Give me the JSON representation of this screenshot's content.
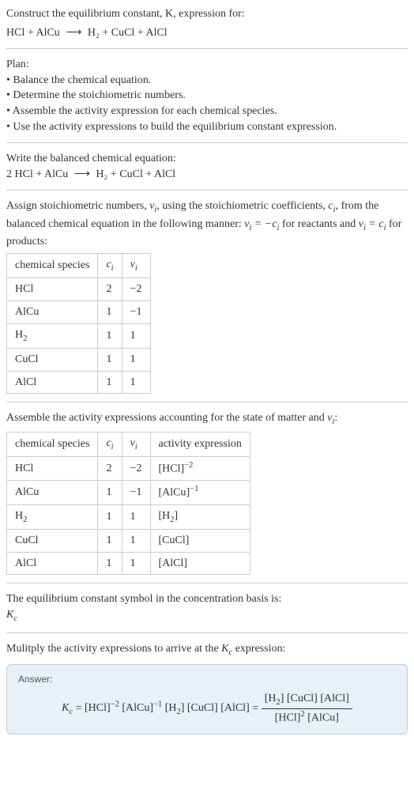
{
  "header": {
    "prompt": "Construct the equilibrium constant, K, expression for:",
    "equation_lhs": "HCl + AlCu",
    "equation_rhs": "H₂ + CuCl + AlCl"
  },
  "plan": {
    "title": "Plan:",
    "items": [
      "Balance the chemical equation.",
      "Determine the stoichiometric numbers.",
      "Assemble the activity expression for each chemical species.",
      "Use the activity expressions to build the equilibrium constant expression."
    ]
  },
  "balanced": {
    "intro": "Write the balanced chemical equation:",
    "equation_lhs": "2 HCl + AlCu",
    "equation_rhs": "H₂ + CuCl + AlCl"
  },
  "stoich": {
    "intro_part1": "Assign stoichiometric numbers, ",
    "intro_part2": ", using the stoichiometric coefficients, ",
    "intro_part3": ", from the balanced chemical equation in the following manner: ",
    "intro_part4": " for reactants and ",
    "intro_part5": " for products:",
    "nu_i": "νᵢ",
    "c_i": "cᵢ",
    "rel1": "νᵢ = −cᵢ",
    "rel2": "νᵢ = cᵢ",
    "headers": [
      "chemical species",
      "cᵢ",
      "νᵢ"
    ],
    "rows": [
      {
        "species": "HCl",
        "ci": "2",
        "vi": "−2"
      },
      {
        "species": "AlCu",
        "ci": "1",
        "vi": "−1"
      },
      {
        "species": "H₂",
        "ci": "1",
        "vi": "1"
      },
      {
        "species": "CuCl",
        "ci": "1",
        "vi": "1"
      },
      {
        "species": "AlCl",
        "ci": "1",
        "vi": "1"
      }
    ]
  },
  "activity": {
    "intro": "Assemble the activity expressions accounting for the state of matter and νᵢ:",
    "headers": [
      "chemical species",
      "cᵢ",
      "νᵢ",
      "activity expression"
    ],
    "rows": [
      {
        "species": "HCl",
        "ci": "2",
        "vi": "−2",
        "expr": "[HCl]⁻²"
      },
      {
        "species": "AlCu",
        "ci": "1",
        "vi": "−1",
        "expr": "[AlCu]⁻¹"
      },
      {
        "species": "H₂",
        "ci": "1",
        "vi": "1",
        "expr": "[H₂]"
      },
      {
        "species": "CuCl",
        "ci": "1",
        "vi": "1",
        "expr": "[CuCl]"
      },
      {
        "species": "AlCl",
        "ci": "1",
        "vi": "1",
        "expr": "[AlCl]"
      }
    ]
  },
  "kc_symbol": {
    "intro": "The equilibrium constant symbol in the concentration basis is:",
    "symbol": "K",
    "symbol_sub": "c"
  },
  "multiply": {
    "intro_part1": "Mulitply the activity expressions to arrive at the ",
    "intro_part2": " expression:",
    "kc": "K",
    "kc_sub": "c"
  },
  "answer": {
    "label": "Answer:",
    "lhs": "Kc = [HCl]⁻² [AlCu]⁻¹ [H₂] [CuCl] [AlCl] =",
    "frac_num": "[H₂] [CuCl] [AlCl]",
    "frac_den": "[HCl]² [AlCu]"
  },
  "chart_data": {
    "type": "table",
    "tables": [
      {
        "title": "Stoichiometric numbers",
        "columns": [
          "chemical species",
          "c_i",
          "nu_i"
        ],
        "rows": [
          [
            "HCl",
            2,
            -2
          ],
          [
            "AlCu",
            1,
            -1
          ],
          [
            "H2",
            1,
            1
          ],
          [
            "CuCl",
            1,
            1
          ],
          [
            "AlCl",
            1,
            1
          ]
        ]
      },
      {
        "title": "Activity expressions",
        "columns": [
          "chemical species",
          "c_i",
          "nu_i",
          "activity expression"
        ],
        "rows": [
          [
            "HCl",
            2,
            -2,
            "[HCl]^-2"
          ],
          [
            "AlCu",
            1,
            -1,
            "[AlCu]^-1"
          ],
          [
            "H2",
            1,
            1,
            "[H2]"
          ],
          [
            "CuCl",
            1,
            1,
            "[CuCl]"
          ],
          [
            "AlCl",
            1,
            1,
            "[AlCl]"
          ]
        ]
      }
    ]
  }
}
